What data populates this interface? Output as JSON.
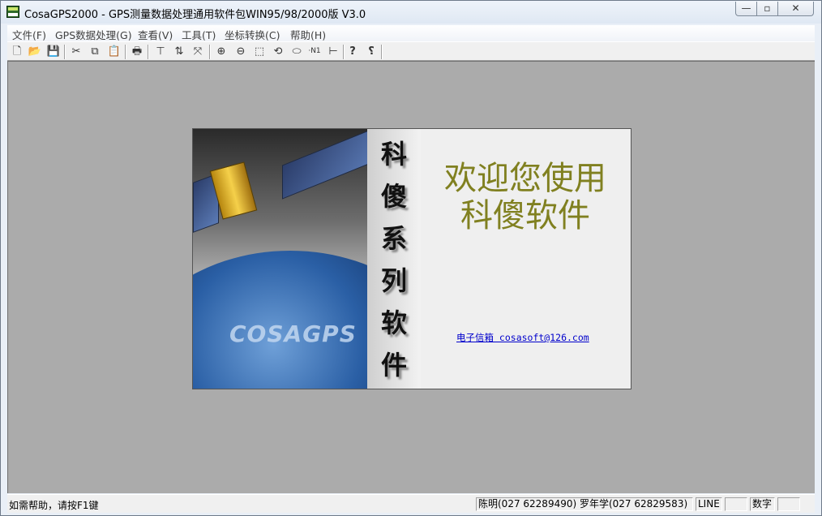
{
  "window": {
    "title": "CosaGPS2000 - GPS测量数据处理通用软件包WIN95/98/2000版 V3.0"
  },
  "titlebar_buttons": {
    "minimize": "—",
    "maximize": "▫",
    "close": "✕"
  },
  "menu": [
    {
      "label": "文件(F)"
    },
    {
      "label": "GPS数据处理(G)"
    },
    {
      "label": "查看(V)"
    },
    {
      "label": "工具(T)"
    },
    {
      "label": "坐标转换(C)"
    },
    {
      "label": "帮助(H)"
    }
  ],
  "toolbar": {
    "new": "🗋",
    "open": "📂",
    "save": "💾",
    "cut": "✂",
    "copy": "⧉",
    "paste": "📋",
    "print": "🖶",
    "tool1": "⊤",
    "tool2": "⇅",
    "tool3": "⤧",
    "zoom_in": "⊕",
    "zoom_out": "⊖",
    "zoom_window": "⬚",
    "zoom_all": "⟲",
    "ellipse": "⬭",
    "n1": "·N1",
    "axis": "⊢",
    "help": "?",
    "context_help": "⸮"
  },
  "splash": {
    "brand_text": "COSAGPS",
    "vertical_chars": [
      "科",
      "傻",
      "系",
      "列",
      "软",
      "件"
    ],
    "welcome_line1": "欢迎您使用",
    "welcome_line2": "科傻软件",
    "email": "电子信箱 cosasoft@126.com"
  },
  "status": {
    "help_text": "如需帮助，请按F1键",
    "contact": "陈明(027 62289490)  罗年学(027 62829583)",
    "line": "LINE",
    "line_val": "",
    "num": "数字",
    "num_val": ""
  },
  "colors": {
    "client_bg": "#ababab",
    "welcome_text": "#808020",
    "email_link": "#0000cc"
  }
}
